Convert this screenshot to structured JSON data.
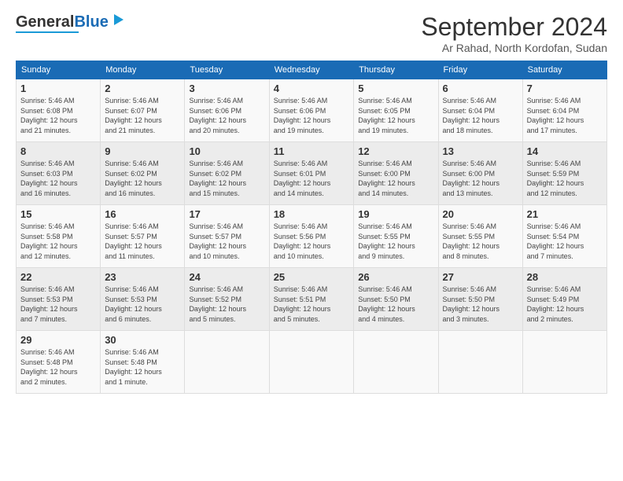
{
  "header": {
    "logo_general": "General",
    "logo_blue": "Blue",
    "month_title": "September 2024",
    "location": "Ar Rahad, North Kordofan, Sudan"
  },
  "weekdays": [
    "Sunday",
    "Monday",
    "Tuesday",
    "Wednesday",
    "Thursday",
    "Friday",
    "Saturday"
  ],
  "weeks": [
    [
      {
        "day": "1",
        "info": "Sunrise: 5:46 AM\nSunset: 6:08 PM\nDaylight: 12 hours\nand 21 minutes."
      },
      {
        "day": "2",
        "info": "Sunrise: 5:46 AM\nSunset: 6:07 PM\nDaylight: 12 hours\nand 21 minutes."
      },
      {
        "day": "3",
        "info": "Sunrise: 5:46 AM\nSunset: 6:06 PM\nDaylight: 12 hours\nand 20 minutes."
      },
      {
        "day": "4",
        "info": "Sunrise: 5:46 AM\nSunset: 6:06 PM\nDaylight: 12 hours\nand 19 minutes."
      },
      {
        "day": "5",
        "info": "Sunrise: 5:46 AM\nSunset: 6:05 PM\nDaylight: 12 hours\nand 19 minutes."
      },
      {
        "day": "6",
        "info": "Sunrise: 5:46 AM\nSunset: 6:04 PM\nDaylight: 12 hours\nand 18 minutes."
      },
      {
        "day": "7",
        "info": "Sunrise: 5:46 AM\nSunset: 6:04 PM\nDaylight: 12 hours\nand 17 minutes."
      }
    ],
    [
      {
        "day": "8",
        "info": "Sunrise: 5:46 AM\nSunset: 6:03 PM\nDaylight: 12 hours\nand 16 minutes."
      },
      {
        "day": "9",
        "info": "Sunrise: 5:46 AM\nSunset: 6:02 PM\nDaylight: 12 hours\nand 16 minutes."
      },
      {
        "day": "10",
        "info": "Sunrise: 5:46 AM\nSunset: 6:02 PM\nDaylight: 12 hours\nand 15 minutes."
      },
      {
        "day": "11",
        "info": "Sunrise: 5:46 AM\nSunset: 6:01 PM\nDaylight: 12 hours\nand 14 minutes."
      },
      {
        "day": "12",
        "info": "Sunrise: 5:46 AM\nSunset: 6:00 PM\nDaylight: 12 hours\nand 14 minutes."
      },
      {
        "day": "13",
        "info": "Sunrise: 5:46 AM\nSunset: 6:00 PM\nDaylight: 12 hours\nand 13 minutes."
      },
      {
        "day": "14",
        "info": "Sunrise: 5:46 AM\nSunset: 5:59 PM\nDaylight: 12 hours\nand 12 minutes."
      }
    ],
    [
      {
        "day": "15",
        "info": "Sunrise: 5:46 AM\nSunset: 5:58 PM\nDaylight: 12 hours\nand 12 minutes."
      },
      {
        "day": "16",
        "info": "Sunrise: 5:46 AM\nSunset: 5:57 PM\nDaylight: 12 hours\nand 11 minutes."
      },
      {
        "day": "17",
        "info": "Sunrise: 5:46 AM\nSunset: 5:57 PM\nDaylight: 12 hours\nand 10 minutes."
      },
      {
        "day": "18",
        "info": "Sunrise: 5:46 AM\nSunset: 5:56 PM\nDaylight: 12 hours\nand 10 minutes."
      },
      {
        "day": "19",
        "info": "Sunrise: 5:46 AM\nSunset: 5:55 PM\nDaylight: 12 hours\nand 9 minutes."
      },
      {
        "day": "20",
        "info": "Sunrise: 5:46 AM\nSunset: 5:55 PM\nDaylight: 12 hours\nand 8 minutes."
      },
      {
        "day": "21",
        "info": "Sunrise: 5:46 AM\nSunset: 5:54 PM\nDaylight: 12 hours\nand 7 minutes."
      }
    ],
    [
      {
        "day": "22",
        "info": "Sunrise: 5:46 AM\nSunset: 5:53 PM\nDaylight: 12 hours\nand 7 minutes."
      },
      {
        "day": "23",
        "info": "Sunrise: 5:46 AM\nSunset: 5:53 PM\nDaylight: 12 hours\nand 6 minutes."
      },
      {
        "day": "24",
        "info": "Sunrise: 5:46 AM\nSunset: 5:52 PM\nDaylight: 12 hours\nand 5 minutes."
      },
      {
        "day": "25",
        "info": "Sunrise: 5:46 AM\nSunset: 5:51 PM\nDaylight: 12 hours\nand 5 minutes."
      },
      {
        "day": "26",
        "info": "Sunrise: 5:46 AM\nSunset: 5:50 PM\nDaylight: 12 hours\nand 4 minutes."
      },
      {
        "day": "27",
        "info": "Sunrise: 5:46 AM\nSunset: 5:50 PM\nDaylight: 12 hours\nand 3 minutes."
      },
      {
        "day": "28",
        "info": "Sunrise: 5:46 AM\nSunset: 5:49 PM\nDaylight: 12 hours\nand 2 minutes."
      }
    ],
    [
      {
        "day": "29",
        "info": "Sunrise: 5:46 AM\nSunset: 5:48 PM\nDaylight: 12 hours\nand 2 minutes."
      },
      {
        "day": "30",
        "info": "Sunrise: 5:46 AM\nSunset: 5:48 PM\nDaylight: 12 hours\nand 1 minute."
      },
      {
        "day": "",
        "info": ""
      },
      {
        "day": "",
        "info": ""
      },
      {
        "day": "",
        "info": ""
      },
      {
        "day": "",
        "info": ""
      },
      {
        "day": "",
        "info": ""
      }
    ]
  ]
}
